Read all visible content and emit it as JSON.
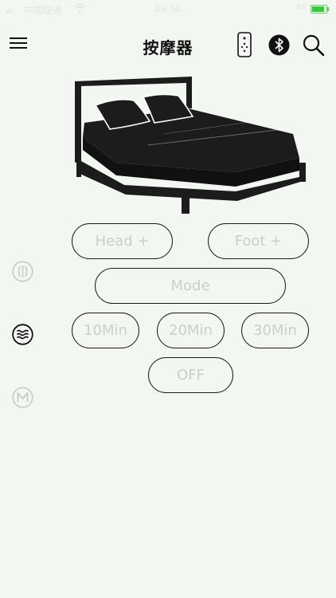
{
  "status_bar": {
    "carrier": "中国联通",
    "time": "09:50",
    "battery_text": "84"
  },
  "header": {
    "title": "按摩器"
  },
  "buttons": {
    "head_plus": "Head +",
    "foot_plus": "Foot +",
    "mode": "Mode",
    "timer_10": "10Min",
    "timer_20": "20Min",
    "timer_30": "30Min",
    "off": "OFF"
  },
  "side_icons": {
    "top": "vibration-icon",
    "middle": "wave-massage-icon",
    "bottom": "memory-m-icon"
  },
  "colors": {
    "background": "#f2f8f1",
    "button_text": "#c9cfc9",
    "button_border": "#1a1a1a",
    "bed": "#1c1c1c",
    "battery": "#3cc83c"
  }
}
